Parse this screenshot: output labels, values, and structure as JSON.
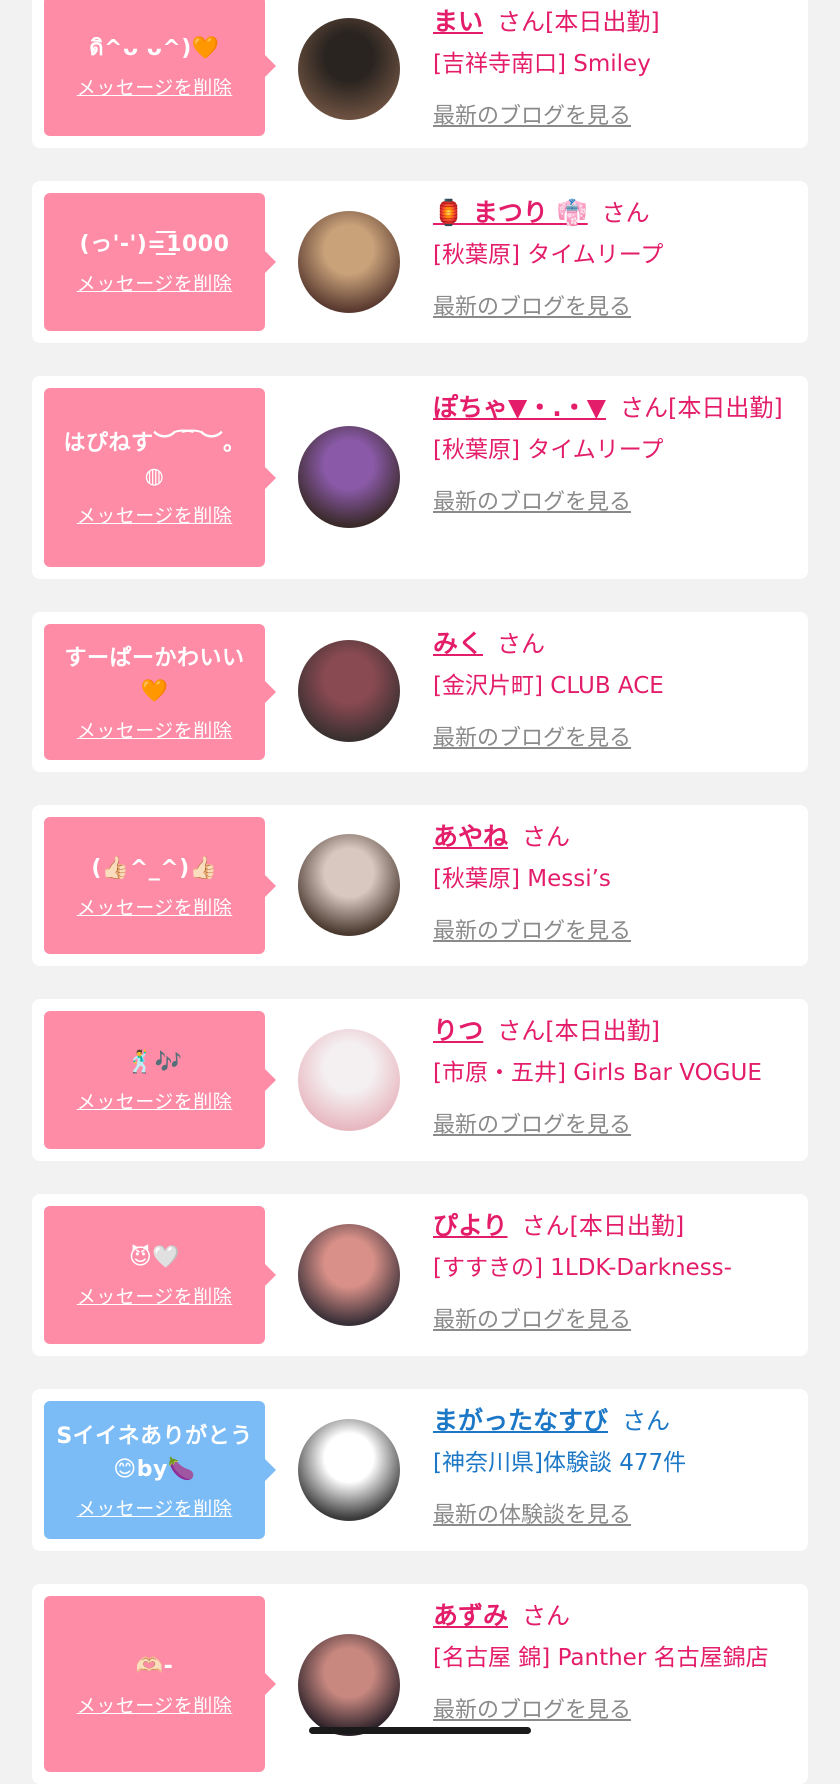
{
  "cards": [
    {
      "msg": "ดิ^ᴗ ᴗ^)🧡",
      "delete": "メッセージを削除",
      "name": "まい",
      "san": "さん[本日出勤]",
      "shop": "[吉祥寺南口] Smiley",
      "blog": "最新のブログを見る",
      "bubble": "pink",
      "avatar_colors": [
        "#2a2420",
        "#6b5040"
      ]
    },
    {
      "msg": "(っ'-')=͟͟͞͞1000",
      "delete": "メッセージを削除",
      "name": "🏮 まつり 👘",
      "san": "さん",
      "shop": "[秋葉原] タイムリープ",
      "blog": "最新のブログを見る",
      "bubble": "pink",
      "avatar_colors": [
        "#c9a27a",
        "#5a3a30"
      ]
    },
    {
      "msg": "はぴねす︶ ͡ ͡ ︶。◍",
      "delete": "メッセージを削除",
      "name": "ぽちゃ▼・.・▼",
      "san": "さん[本日出勤]",
      "shop": "[秋葉原] タイムリープ",
      "blog": "最新のブログを見る",
      "bubble": "pink",
      "avatar_colors": [
        "#8a5aa8",
        "#3a2a2a"
      ]
    },
    {
      "msg": "すーぱーかわいい🧡",
      "delete": "メッセージを削除",
      "name": "みく",
      "san": "さん",
      "shop": "[金沢片町] CLUB ACE",
      "blog": "最新のブログを見る",
      "bubble": "pink",
      "avatar_colors": [
        "#8a4a52",
        "#3a3030"
      ]
    },
    {
      "msg": "(👍🏻^_^)👍🏻",
      "delete": "メッセージを削除",
      "name": "あやね",
      "san": "さん",
      "shop": "[秋葉原] Messi’s",
      "blog": "最新のブログを見る",
      "bubble": "pink",
      "avatar_colors": [
        "#d8c8c0",
        "#4a3a30"
      ]
    },
    {
      "msg": "🕺🎶",
      "delete": "メッセージを削除",
      "name": "りつ",
      "san": "さん[本日出勤]",
      "shop": "[市原・五井] Girls Bar VOGUE",
      "blog": "最新のブログを見る",
      "bubble": "pink",
      "avatar_colors": [
        "#f4f0f2",
        "#e8b8c0"
      ]
    },
    {
      "msg": "😈🤍",
      "delete": "メッセージを削除",
      "name": "ぴより",
      "san": "さん[本日出勤]",
      "shop": "[すすきの] 1LDK-Darkness-",
      "blog": "最新のブログを見る",
      "bubble": "pink",
      "avatar_colors": [
        "#d89088",
        "#3a3038"
      ]
    },
    {
      "msg": "Sイイネありがとう😊by🍆",
      "delete": "メッセージを削除",
      "name": "まがったなすび",
      "san": "さん",
      "shop": "[神奈川県]体験談 477件",
      "blog": "最新の体験談を見る",
      "bubble": "blue",
      "avatar_colors": [
        "#ffffff",
        "#3a3a3a"
      ]
    },
    {
      "msg": "🫶🏻-",
      "delete": "メッセージを削除",
      "name": "あずみ",
      "san": "さん",
      "shop": "[名古屋 錦] Panther 名古屋錦店",
      "blog": "最新のブログを見る",
      "bubble": "pink",
      "avatar_colors": [
        "#c88880",
        "#2a2028"
      ]
    }
  ]
}
